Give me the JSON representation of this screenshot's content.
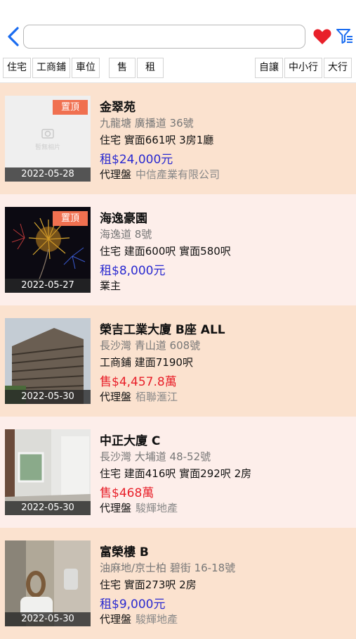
{
  "search": {
    "value": "",
    "placeholder": ""
  },
  "filters": {
    "left": [
      "住宅",
      "工商鋪",
      "車位"
    ],
    "mid": [
      "售",
      "租"
    ],
    "right": [
      "自讓",
      "中小行",
      "大行"
    ]
  },
  "listings": [
    {
      "pinned": true,
      "pin_label": "置頂",
      "date": "2022-05-28",
      "title": "金翠苑",
      "address": "九龍塘 廣播道 36號",
      "spec": "住宅  實面661呎 3房1廳",
      "price": "租$24,000元",
      "price_type": "rent",
      "agent_type": "代理盤",
      "agent_company": "中信產業有限公司",
      "no_photo_text": "暫無相片"
    },
    {
      "pinned": true,
      "pin_label": "置頂",
      "date": "2022-05-27",
      "title": "海逸豪園",
      "address": "海逸道 8號",
      "spec": "住宅  建面600呎  實面580呎",
      "price": "租$8,000元",
      "price_type": "rent",
      "agent_type": "業主",
      "agent_company": ""
    },
    {
      "pinned": false,
      "date": "2022-05-30",
      "title": "榮吉工業大廈 B座 ALL",
      "address": "長沙灣 青山道 608號",
      "spec": "工商鋪  建面7190呎",
      "price": "售$4,457.8萬",
      "price_type": "sale",
      "agent_type": "代理盤",
      "agent_company": "栢聯滙江"
    },
    {
      "pinned": false,
      "date": "2022-05-30",
      "title": "中正大廈 C",
      "address": "長沙灣 大埔道 48-52號",
      "spec": "住宅  建面416呎  實面292呎  2房",
      "price": "售$468萬",
      "price_type": "sale",
      "agent_type": "代理盤",
      "agent_company": "駿輝地產"
    },
    {
      "pinned": false,
      "date": "2022-05-30",
      "title": "富榮樓 B",
      "address": "油麻地/京士柏  碧街 16-18號",
      "spec": "住宅  實面273呎  2房",
      "price": "租$9,000元",
      "price_type": "rent",
      "agent_type": "代理盤",
      "agent_company": "駿輝地產"
    }
  ],
  "colors": {
    "accent": "#1a6cf0",
    "heart": "#e8202a",
    "rent": "#2a2ad0",
    "sale": "#e8202a",
    "pin": "#f07050",
    "row_a": "#fbe2cf",
    "row_b": "#fdeeea"
  },
  "icons": {
    "back": "chevron-left-icon",
    "favorite": "heart-icon",
    "filter": "filter-icon"
  }
}
